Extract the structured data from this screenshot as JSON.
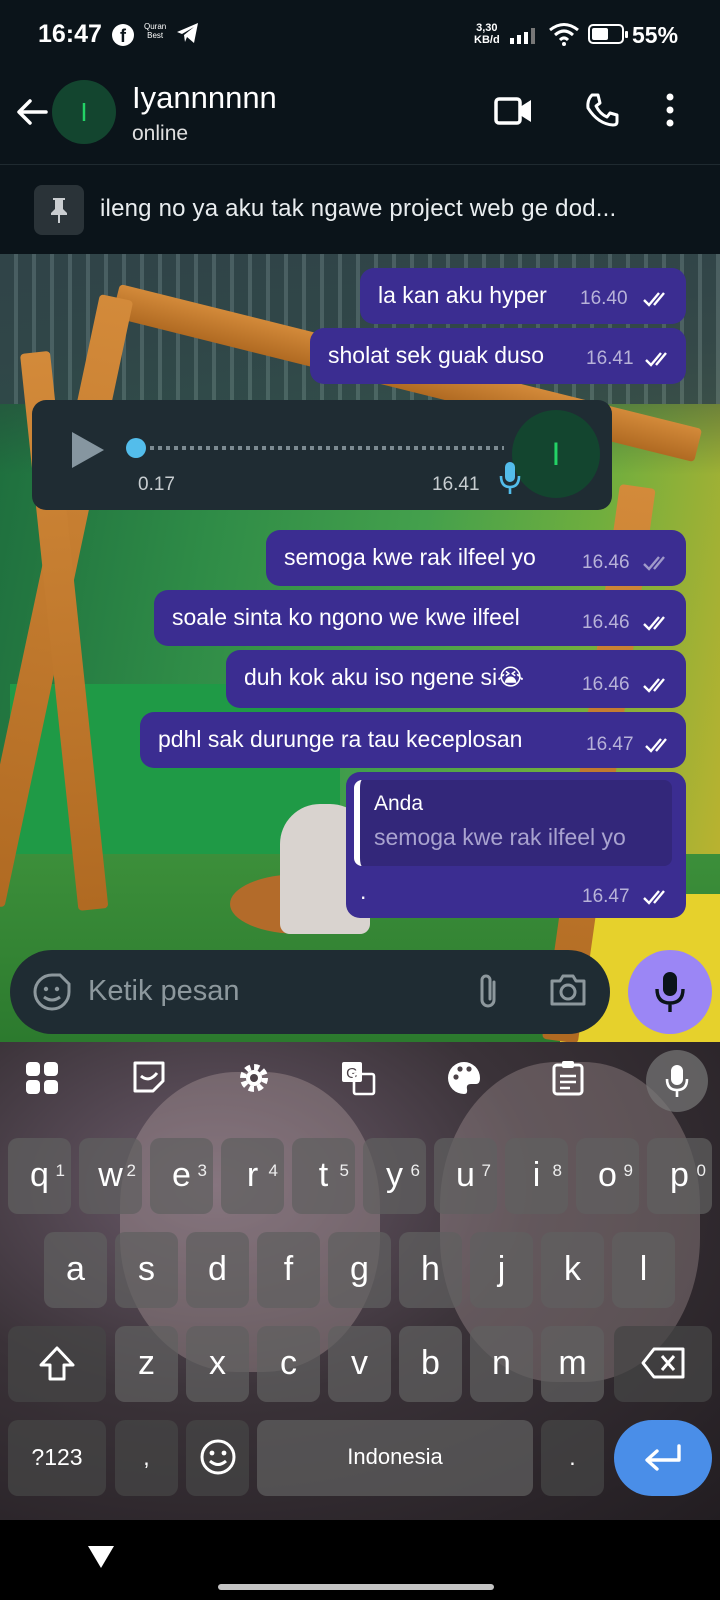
{
  "status_bar": {
    "time": "16:47",
    "notif_quran": [
      "Quran",
      "Best"
    ],
    "net_speed": [
      "3,30",
      "KB/d"
    ],
    "battery": "55%"
  },
  "header": {
    "avatar_initial": "I",
    "contact_name": "Iyannnnnn",
    "contact_status": "online"
  },
  "pinned": {
    "text": "ileng no ya aku tak ngawe project web ge dod..."
  },
  "messages": [
    {
      "text": "la kan aku hyper",
      "time": "16.40",
      "ticks": "read"
    },
    {
      "text": "sholat sek guak duso",
      "time": "16.41",
      "ticks": "read"
    },
    {
      "type": "voice",
      "duration": "0.17",
      "time": "16.41",
      "avatar_initial": "I"
    },
    {
      "text": "semoga kwe rak ilfeel yo",
      "time": "16.46",
      "ticks": "delivered"
    },
    {
      "text": "soale sinta ko ngono we kwe ilfeel",
      "time": "16.46",
      "ticks": "read"
    },
    {
      "text": "duh kok aku iso ngene si",
      "emoji": "😭",
      "time": "16.46",
      "ticks": "read"
    },
    {
      "text": "pdhl sak durunge ra tau keceplosan",
      "time": "16.47",
      "ticks": "read"
    },
    {
      "type": "reply",
      "quote_author": "Anda",
      "quote_text": "semoga kwe rak ilfeel yo",
      "text": ".",
      "time": "16.47",
      "ticks": "read"
    }
  ],
  "composer": {
    "placeholder": "Ketik pesan"
  },
  "keyboard": {
    "row1": [
      {
        "k": "q",
        "n": "1"
      },
      {
        "k": "w",
        "n": "2"
      },
      {
        "k": "e",
        "n": "3"
      },
      {
        "k": "r",
        "n": "4"
      },
      {
        "k": "t",
        "n": "5"
      },
      {
        "k": "y",
        "n": "6"
      },
      {
        "k": "u",
        "n": "7"
      },
      {
        "k": "i",
        "n": "8"
      },
      {
        "k": "o",
        "n": "9"
      },
      {
        "k": "p",
        "n": "0"
      }
    ],
    "row2": [
      "a",
      "s",
      "d",
      "f",
      "g",
      "h",
      "j",
      "k",
      "l"
    ],
    "row3": [
      "z",
      "x",
      "c",
      "v",
      "b",
      "n",
      "m"
    ],
    "symbols_label": "?123",
    "comma": ",",
    "space_label": "Indonesia",
    "period": "."
  },
  "colors": {
    "outgoing_bubble": "#3b2d91",
    "header_bg": "#0b141a",
    "read_tick": "#ffffff",
    "mic_button": "#9b86f5",
    "enter_key": "#4a8ee8"
  }
}
